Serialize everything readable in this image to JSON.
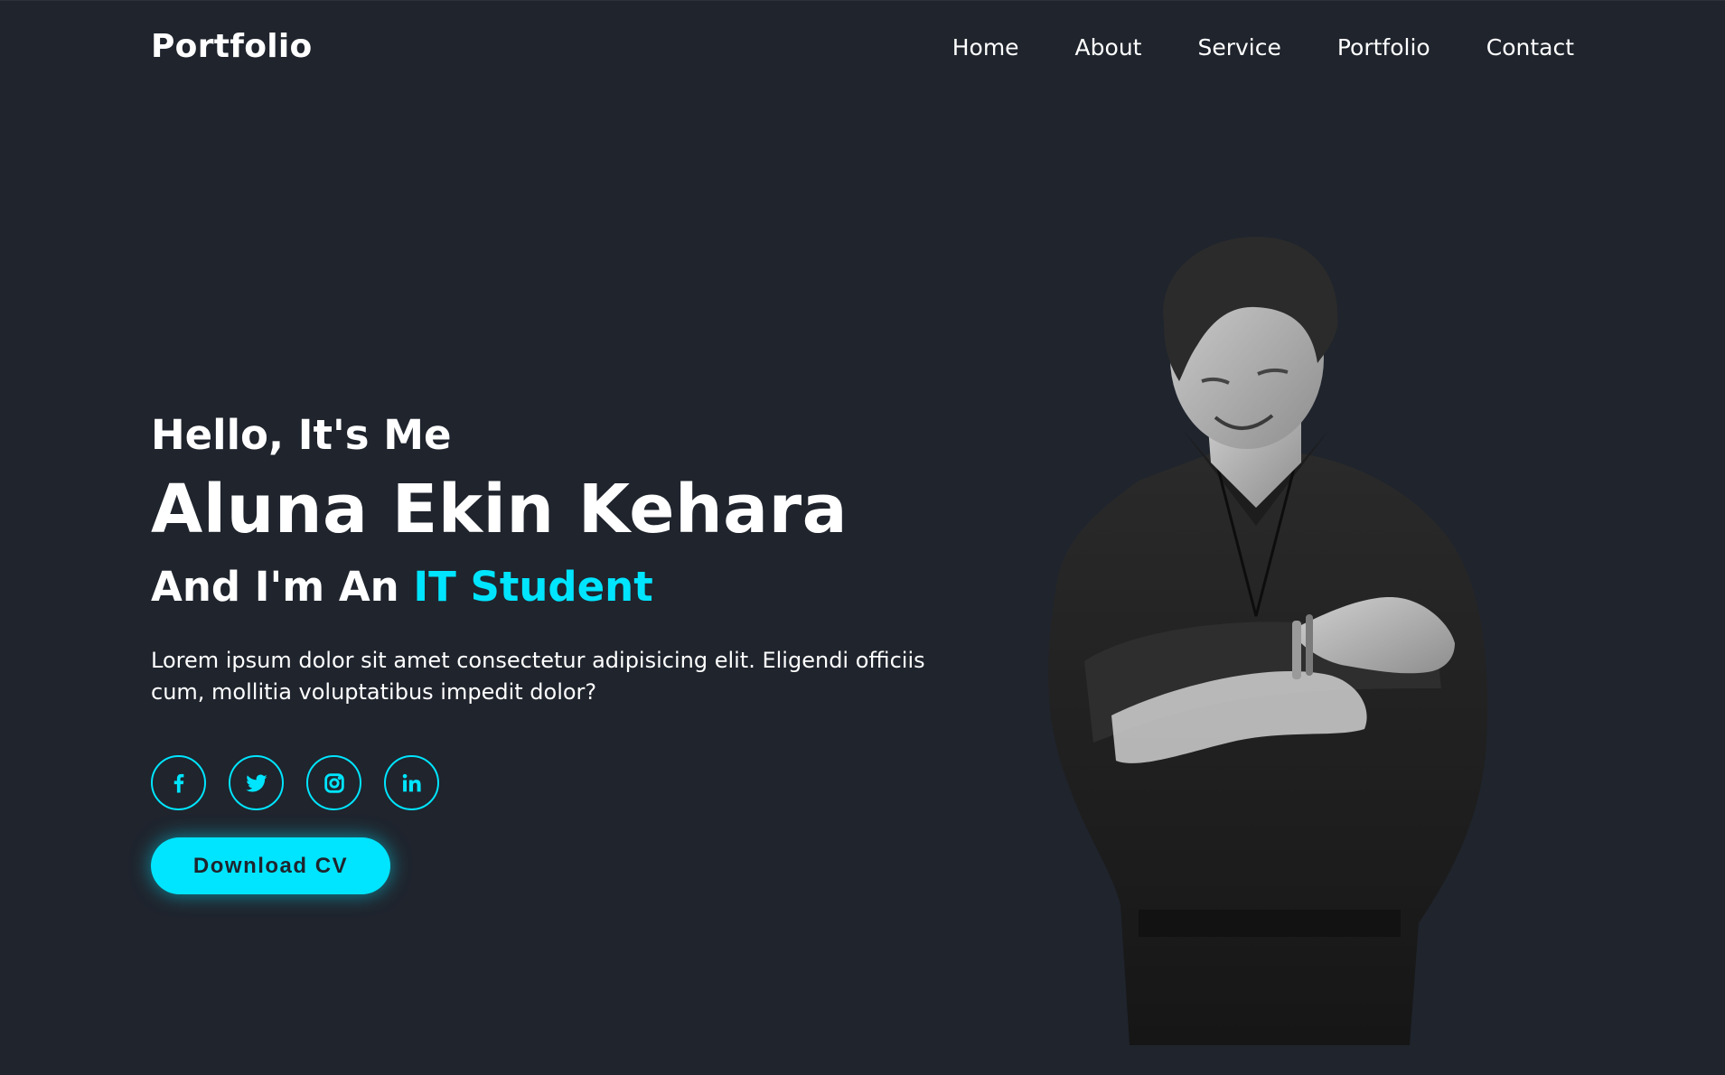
{
  "header": {
    "logo": "Portfolio",
    "nav": [
      "Home",
      "About",
      "Service",
      "Portfolio",
      "Contact"
    ]
  },
  "hero": {
    "greeting": "Hello, It's Me",
    "name": "Aluna Ekin Kehara",
    "role_prefix": "And I'm An ",
    "role_highlight": "IT Student",
    "description": "Lorem ipsum dolor sit amet consectetur adipisicing elit. Eligendi officiis cum, mollitia voluptatibus impedit dolor?",
    "socials": [
      "facebook-icon",
      "twitter-icon",
      "instagram-icon",
      "linkedin-icon"
    ],
    "cta": "Download CV"
  },
  "colors": {
    "background": "#1f242d",
    "accent": "#00e5ff",
    "text": "#ffffff"
  }
}
